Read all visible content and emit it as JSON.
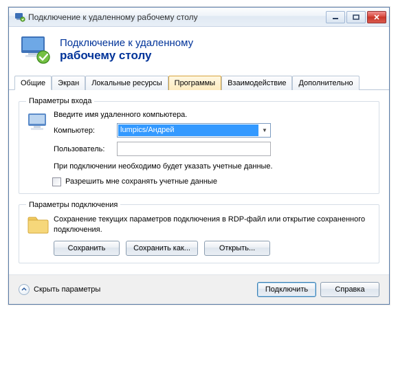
{
  "titlebar": {
    "title": "Подключение к удаленному рабочему столу"
  },
  "banner": {
    "line1": "Подключение к удаленному",
    "line2": "рабочему столу"
  },
  "tabs": {
    "general": "Общие",
    "display": "Экран",
    "local": "Локальные ресурсы",
    "programs": "Программы",
    "experience": "Взаимодействие",
    "advanced": "Дополнительно"
  },
  "login": {
    "legend": "Параметры входа",
    "hint": "Введите имя удаленного компьютера.",
    "computer_label": "Компьютер:",
    "computer_value": "lumpics/Андрей",
    "user_label": "Пользователь:",
    "note": "При подключении необходимо будет указать учетные данные.",
    "save_creds": "Разрешить мне сохранять учетные данные"
  },
  "conn": {
    "legend": "Параметры подключения",
    "desc": "Сохранение текущих параметров подключения в RDP-файл или открытие сохраненного подключения.",
    "save": "Сохранить",
    "save_as": "Сохранить как...",
    "open": "Открыть..."
  },
  "footer": {
    "collapse": "Скрыть параметры",
    "connect": "Подключить",
    "help": "Справка"
  }
}
